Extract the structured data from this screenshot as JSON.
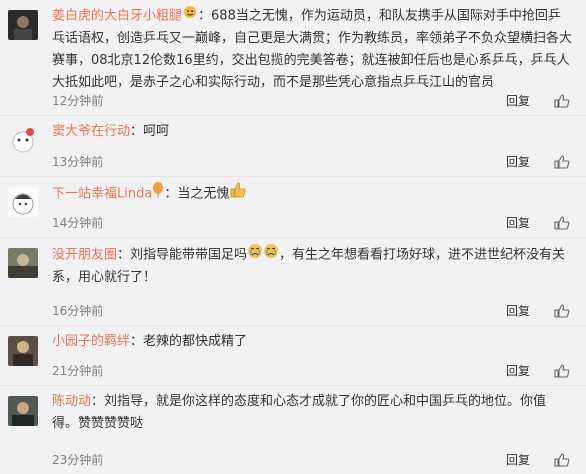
{
  "comments": [
    {
      "user": "姜白虎的大白牙小粗腿",
      "text": "688当之无愧，作为运动员，和队友携手从国际对手中抢回乒乓话语权，创造乒乓又一巅峰，自己更是大满贯；作为教练员，率领弟子不负众望横扫各大赛事，08北京12伦数16里约，交出包揽的完美答卷；就连被卸任后也是心系乒乓，乒乓人大抵如此吧，是赤子之心和实际行动，而不是那些凭心意指点乒乓江山的官员",
      "time": "12分钟前",
      "reply": "回复"
    },
    {
      "user": "窦大爷在行动",
      "text": "呵呵",
      "time": "13分钟前",
      "reply": "回复"
    },
    {
      "user": "下一站幸福Linda",
      "text": "当之无愧",
      "time": "14分钟前",
      "reply": "回复"
    },
    {
      "user": "没开朋友圈",
      "text_a": "刘指导能带带国足吗",
      "text_b": "，有生之年想看看打场好球，进不进世纪杯没有关系，用心就行了！",
      "time": "16分钟前",
      "reply": "回复"
    },
    {
      "user": "小园子的羁绊",
      "text": "老辣的都快成精了",
      "time": "21分钟前",
      "reply": "回复"
    },
    {
      "user": "陈动动",
      "text": "刘指导，就是你这样的态度和心态才成就了你的匠心和中国乒乓的地位。你值得。赞赞赞赞哒",
      "time": "23分钟前",
      "reply": "回复"
    }
  ],
  "colors": {
    "username": "#eb7350",
    "time": "#808080",
    "background": "#f2f2f5"
  },
  "icons": {
    "like": "thumbs-up-icon",
    "emoji_fire": "fire-face-emoji",
    "emoji_balloon": "balloon-emoji",
    "emoji_thumb": "thumbs-up-emoji",
    "emoji_cry": "crying-face-emoji"
  }
}
